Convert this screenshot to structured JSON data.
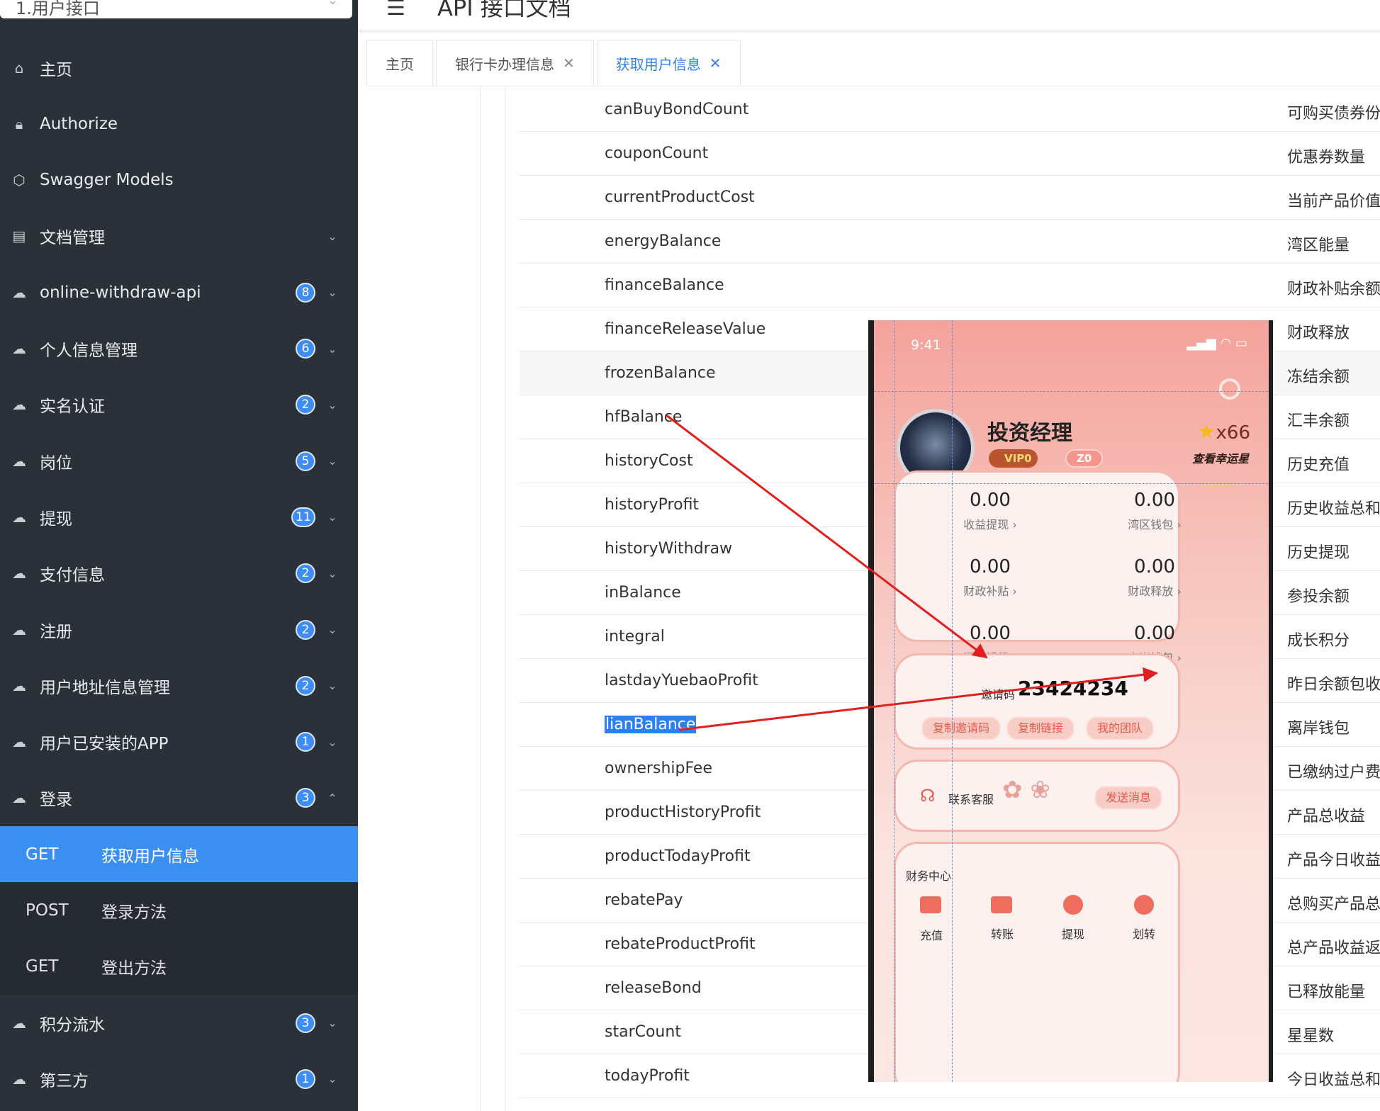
{
  "sidebar": {
    "group_select": "1.用户接口",
    "items": [
      {
        "label": "主页",
        "icon": "home-icon"
      },
      {
        "label": "Authorize",
        "icon": "lock-icon"
      },
      {
        "label": "Swagger Models",
        "icon": "cube-icon"
      },
      {
        "label": "文档管理",
        "icon": "document-icon",
        "arrow": "⌄"
      },
      {
        "label": "online-withdraw-api",
        "icon": "cloud-api-icon",
        "badge": "8",
        "arrow": "⌄"
      },
      {
        "label": "个人信息管理",
        "icon": "cloud-api-icon",
        "badge": "6",
        "arrow": "⌄"
      },
      {
        "label": "实名认证",
        "icon": "cloud-api-icon",
        "badge": "2",
        "arrow": "⌄"
      },
      {
        "label": "岗位",
        "icon": "cloud-api-icon",
        "badge": "5",
        "arrow": "⌄"
      },
      {
        "label": "提现",
        "icon": "cloud-api-icon",
        "badge": "11",
        "arrow": "⌄"
      },
      {
        "label": "支付信息",
        "icon": "cloud-api-icon",
        "badge": "2",
        "arrow": "⌄"
      },
      {
        "label": "注册",
        "icon": "cloud-api-icon",
        "badge": "2",
        "arrow": "⌄"
      },
      {
        "label": "用户地址信息管理",
        "icon": "cloud-api-icon",
        "badge": "2",
        "arrow": "⌄"
      },
      {
        "label": "用户已安装的APP",
        "icon": "cloud-api-icon",
        "badge": "1",
        "arrow": "⌄"
      },
      {
        "label": "登录",
        "icon": "cloud-api-icon",
        "badge": "3",
        "arrow": "⌃"
      }
    ],
    "sub_items": [
      {
        "method": "GET",
        "label": "获取用户信息",
        "active": true
      },
      {
        "method": "POST",
        "label": "登录方法"
      },
      {
        "method": "GET",
        "label": "登出方法"
      }
    ],
    "items_after": [
      {
        "label": "积分流水",
        "icon": "cloud-api-icon",
        "badge": "3",
        "arrow": "⌄"
      },
      {
        "label": "第三方",
        "icon": "cloud-api-icon",
        "badge": "1",
        "arrow": "⌄"
      }
    ]
  },
  "header": {
    "title": "API 接口文档",
    "menu_icon": "hamburger-icon"
  },
  "tabs": [
    {
      "label": "主页",
      "closable": false
    },
    {
      "label": "银行卡办理信息",
      "closable": true
    },
    {
      "label": "获取用户信息",
      "closable": true,
      "active": true
    }
  ],
  "fields": [
    {
      "name": "canBuyBondCount",
      "desc": "可购买债券份"
    },
    {
      "name": "couponCount",
      "desc": "优惠券数量"
    },
    {
      "name": "currentProductCost",
      "desc": "当前产品价值"
    },
    {
      "name": "energyBalance",
      "desc": "湾区能量"
    },
    {
      "name": "financeBalance",
      "desc": "财政补贴余额"
    },
    {
      "name": "financeReleaseValue",
      "desc": "财政释放"
    },
    {
      "name": "frozenBalance",
      "desc": "冻结余额"
    },
    {
      "name": "hfBalance",
      "desc": "汇丰余额"
    },
    {
      "name": "historyCost",
      "desc": "历史充值"
    },
    {
      "name": "historyProfit",
      "desc": "历史收益总和"
    },
    {
      "name": "historyWithdraw",
      "desc": "历史提现"
    },
    {
      "name": "inBalance",
      "desc": "参投余额"
    },
    {
      "name": "integral",
      "desc": "成长积分"
    },
    {
      "name": "lastdayYuebaoProfit",
      "desc": "昨日余额包收"
    },
    {
      "name": "lianBalance",
      "desc": "离岸钱包"
    },
    {
      "name": "ownershipFee",
      "desc": "已缴纳过户费"
    },
    {
      "name": "productHistoryProfit",
      "desc": "产品总收益"
    },
    {
      "name": "productTodayProfit",
      "desc": "产品今日收益"
    },
    {
      "name": "rebatePay",
      "desc": "总购买产品总"
    },
    {
      "name": "rebateProductProfit",
      "desc": "总产品收益返"
    },
    {
      "name": "releaseBond",
      "desc": "已释放能量"
    },
    {
      "name": "starCount",
      "desc": "星星数"
    },
    {
      "name": "todayProfit",
      "desc": "今日收益总和"
    }
  ],
  "phone": {
    "time": "9:41",
    "username": "投资经理",
    "vip": "VIP0",
    "z_badge": "Z0",
    "star_count": "x66",
    "lucky": "查看幸运星",
    "stats": [
      {
        "value": "0.00",
        "label": "收益提现 ›"
      },
      {
        "value": "0.00",
        "label": "湾区钱包 ›"
      },
      {
        "value": "0.00",
        "label": "财政补贴 ›"
      },
      {
        "value": "0.00",
        "label": "财政释放 ›"
      },
      {
        "value": "0.00",
        "label": "汇丰银行 ›"
      },
      {
        "value": "0.00",
        "label": "离岸钱包 ›"
      }
    ],
    "invite_label": "邀请码",
    "invite_code": "23424234",
    "pills": [
      "复制邀请码",
      "复制链接",
      "我的团队"
    ],
    "service_label": "联系客服",
    "send_msg": "发送消息",
    "finance_title": "财务中心",
    "finance_items": [
      "充值",
      "转账",
      "提现",
      "划转"
    ]
  },
  "colors": {
    "sidebar_bg": "#2b3138",
    "accent": "#3a8ff0",
    "arrow_red": "#e02020"
  }
}
